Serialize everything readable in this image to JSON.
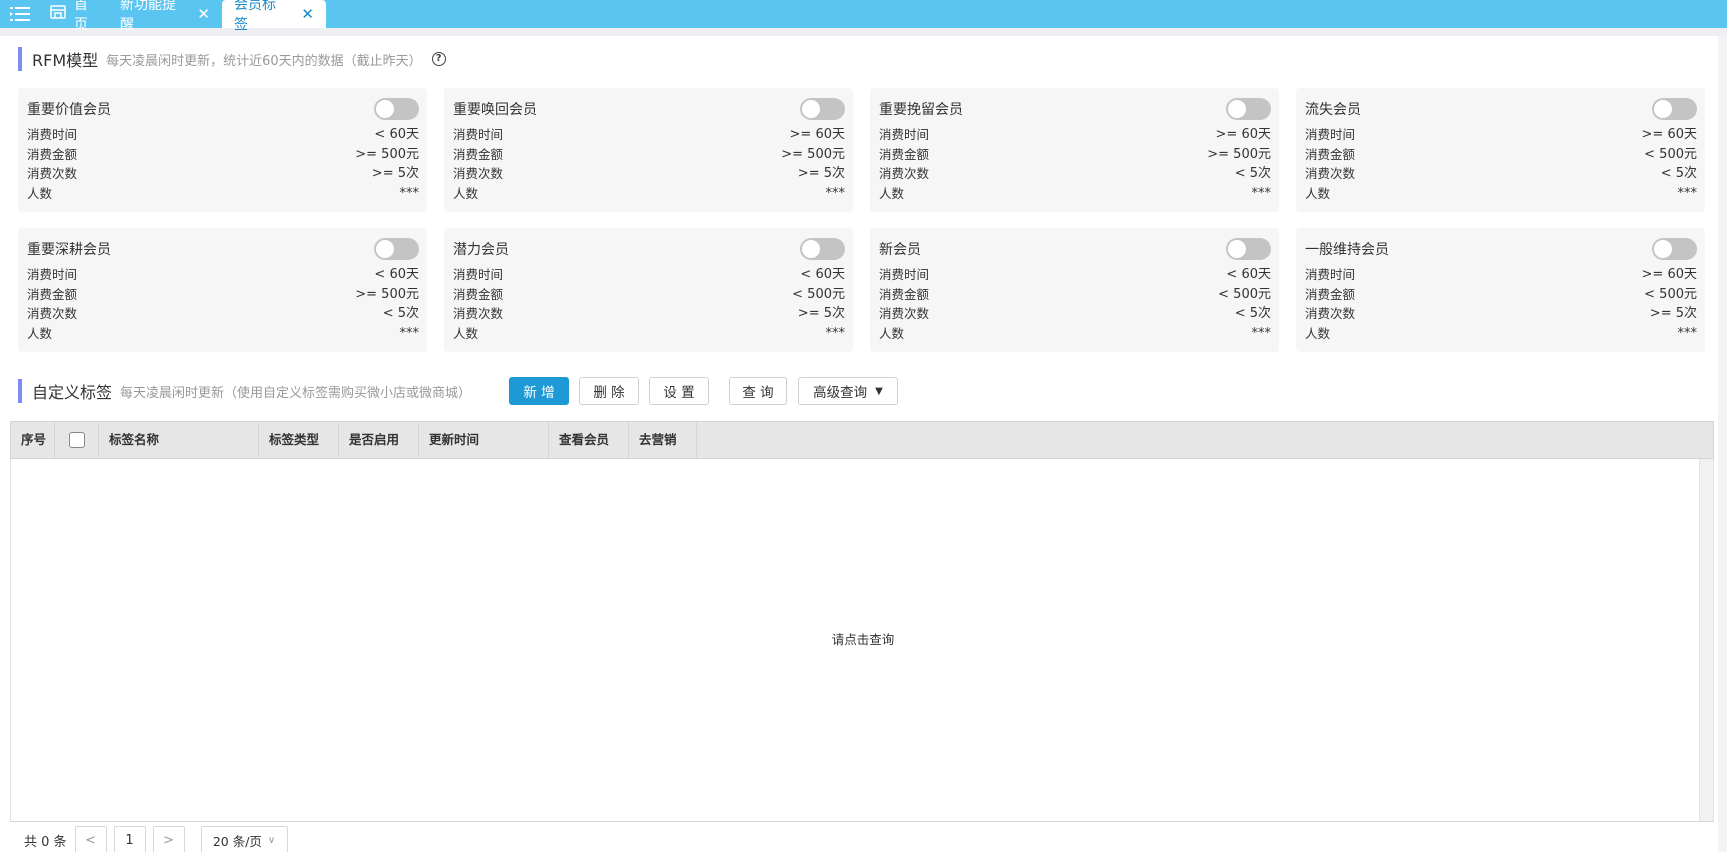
{
  "topbar": {
    "tabs": [
      {
        "label": "首页",
        "closable": false
      },
      {
        "label": "新功能提醒",
        "closable": true
      },
      {
        "label": "会员标签",
        "closable": true,
        "active": true
      }
    ]
  },
  "rfm": {
    "title": "RFM模型",
    "desc": "每天凌晨闲时更新，统计近60天内的数据（截止昨天）",
    "help": "?",
    "cards": [
      {
        "name": "重要价值会员",
        "enabled": false,
        "rows": [
          {
            "label": "消费时间",
            "value": "< 60天"
          },
          {
            "label": "消费金额",
            "value": ">= 500元"
          },
          {
            "label": "消费次数",
            "value": ">= 5次"
          },
          {
            "label": "人数",
            "value": "***"
          }
        ]
      },
      {
        "name": "重要唤回会员",
        "enabled": false,
        "rows": [
          {
            "label": "消费时间",
            "value": ">= 60天"
          },
          {
            "label": "消费金额",
            "value": ">= 500元"
          },
          {
            "label": "消费次数",
            "value": ">= 5次"
          },
          {
            "label": "人数",
            "value": "***"
          }
        ]
      },
      {
        "name": "重要挽留会员",
        "enabled": false,
        "rows": [
          {
            "label": "消费时间",
            "value": ">= 60天"
          },
          {
            "label": "消费金额",
            "value": ">= 500元"
          },
          {
            "label": "消费次数",
            "value": "< 5次"
          },
          {
            "label": "人数",
            "value": "***"
          }
        ]
      },
      {
        "name": "流失会员",
        "enabled": false,
        "rows": [
          {
            "label": "消费时间",
            "value": ">= 60天"
          },
          {
            "label": "消费金额",
            "value": "< 500元"
          },
          {
            "label": "消费次数",
            "value": "< 5次"
          },
          {
            "label": "人数",
            "value": "***"
          }
        ]
      },
      {
        "name": "重要深耕会员",
        "enabled": false,
        "rows": [
          {
            "label": "消费时间",
            "value": "< 60天"
          },
          {
            "label": "消费金额",
            "value": ">= 500元"
          },
          {
            "label": "消费次数",
            "value": "< 5次"
          },
          {
            "label": "人数",
            "value": "***"
          }
        ]
      },
      {
        "name": "潜力会员",
        "enabled": false,
        "rows": [
          {
            "label": "消费时间",
            "value": "< 60天"
          },
          {
            "label": "消费金额",
            "value": "< 500元"
          },
          {
            "label": "消费次数",
            "value": ">= 5次"
          },
          {
            "label": "人数",
            "value": "***"
          }
        ]
      },
      {
        "name": "新会员",
        "enabled": false,
        "rows": [
          {
            "label": "消费时间",
            "value": "< 60天"
          },
          {
            "label": "消费金额",
            "value": "< 500元"
          },
          {
            "label": "消费次数",
            "value": "< 5次"
          },
          {
            "label": "人数",
            "value": "***"
          }
        ]
      },
      {
        "name": "一般维持会员",
        "enabled": false,
        "rows": [
          {
            "label": "消费时间",
            "value": ">= 60天"
          },
          {
            "label": "消费金额",
            "value": "< 500元"
          },
          {
            "label": "消费次数",
            "value": ">= 5次"
          },
          {
            "label": "人数",
            "value": "***"
          }
        ]
      }
    ]
  },
  "custom": {
    "title": "自定义标签",
    "desc": "每天凌晨闲时更新（使用自定义标签需购买微小店或微商城）",
    "buttons": {
      "add": "新 增",
      "delete": "删 除",
      "settings": "设 置",
      "query": "查 询",
      "advanced_query": "高级查询"
    }
  },
  "table": {
    "columns": [
      "序号",
      "",
      "标签名称",
      "标签类型",
      "是否启用",
      "更新时间",
      "查看会员",
      "去营销"
    ],
    "rows": [],
    "empty_text": "请点击查询"
  },
  "pagination": {
    "total_text": "共 0 条",
    "prev": "<",
    "current_page": "1",
    "next": ">",
    "page_size": "20 条/页"
  }
}
